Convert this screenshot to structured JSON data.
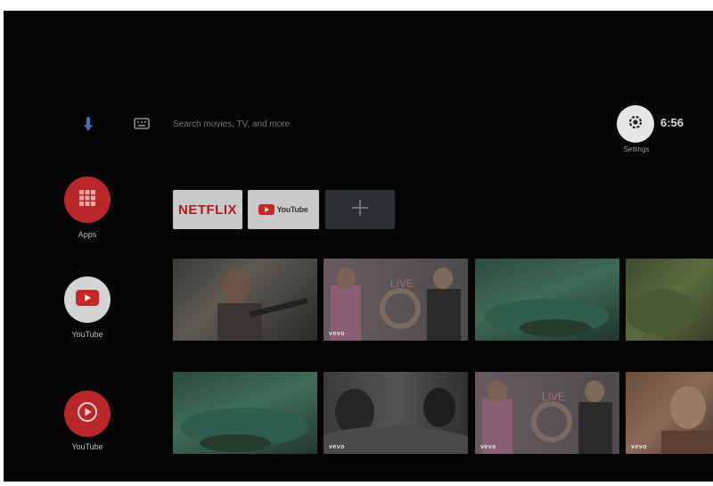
{
  "topbar": {
    "search_placeholder": "Search movies, TV, and more",
    "settings_label": "Settings",
    "time": "6:56"
  },
  "rail": {
    "items": [
      {
        "label": "Apps",
        "icon": "apps-grid-icon"
      },
      {
        "label": "YouTube",
        "icon": "youtube-play-icon"
      },
      {
        "label": "YouTube",
        "icon": "youtube-circle-play-icon"
      }
    ]
  },
  "apps_row": {
    "netflix_label": "NETFLIX",
    "youtube_label": "YouTube"
  },
  "rows": {
    "vevo": "vevo"
  },
  "colors": {
    "accent_red": "#c62828",
    "background": "#050505",
    "settings_bg": "#e7e7e7"
  }
}
